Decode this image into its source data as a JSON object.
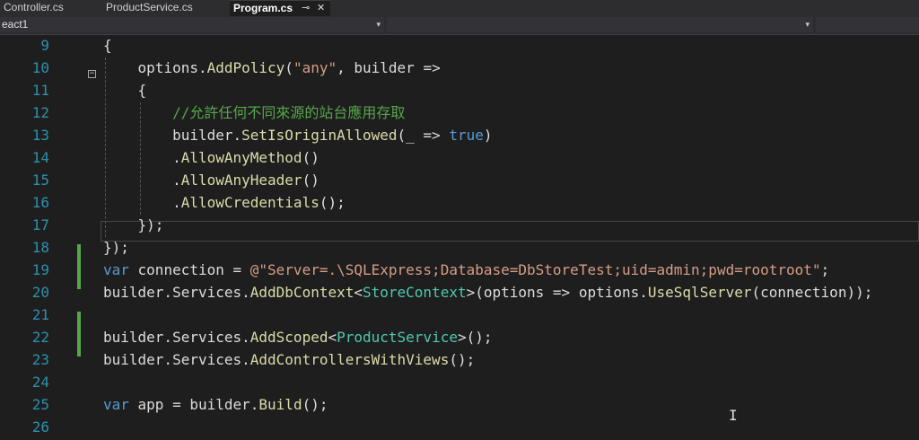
{
  "tabs": [
    {
      "label": "Controller.cs"
    },
    {
      "label": "ProductService.cs"
    },
    {
      "label": "Program.cs",
      "pin": "⊸",
      "close": "✕"
    }
  ],
  "nav": {
    "project": "eact1",
    "left_arrow": "▾",
    "right_arrow": "▾"
  },
  "editor": {
    "line_numbers": [
      "9",
      "10",
      "11",
      "12",
      "13",
      "14",
      "15",
      "16",
      "17",
      "18",
      "19",
      "20",
      "21",
      "22",
      "23",
      "24",
      "25",
      "26"
    ],
    "lines": [
      {
        "n": "9",
        "tokens": [
          {
            "t": "{"
          }
        ]
      },
      {
        "n": "10",
        "tokens": [
          {
            "t": "    options."
          },
          {
            "t": "AddPolicy",
            "c": "mt"
          },
          {
            "t": "("
          },
          {
            "t": "\"any\"",
            "c": "str"
          },
          {
            "t": ", builder =>"
          }
        ]
      },
      {
        "n": "11",
        "tokens": [
          {
            "t": "    {"
          }
        ]
      },
      {
        "n": "12",
        "tokens": [
          {
            "t": "        "
          },
          {
            "t": "//允許任何不同來源的站台應用存取",
            "c": "cm"
          }
        ]
      },
      {
        "n": "13",
        "tokens": [
          {
            "t": "        builder."
          },
          {
            "t": "SetIsOriginAllowed",
            "c": "mt"
          },
          {
            "t": "(_ => "
          },
          {
            "t": "true",
            "c": "kw"
          },
          {
            "t": ")"
          }
        ]
      },
      {
        "n": "14",
        "tokens": [
          {
            "t": "        ."
          },
          {
            "t": "AllowAnyMethod",
            "c": "mt"
          },
          {
            "t": "()"
          }
        ]
      },
      {
        "n": "15",
        "tokens": [
          {
            "t": "        ."
          },
          {
            "t": "AllowAnyHeader",
            "c": "mt"
          },
          {
            "t": "()"
          }
        ]
      },
      {
        "n": "16",
        "tokens": [
          {
            "t": "        ."
          },
          {
            "t": "AllowCredentials",
            "c": "mt"
          },
          {
            "t": "();"
          }
        ]
      },
      {
        "n": "17",
        "tokens": [
          {
            "t": "    });"
          }
        ]
      },
      {
        "n": "18",
        "tokens": [
          {
            "t": "});"
          }
        ]
      },
      {
        "n": "19",
        "tokens": [
          {
            "t": "var",
            "c": "kw"
          },
          {
            "t": " connection = "
          },
          {
            "t": "@\"Server=.\\SQLExpress;Database=DbStoreTest;uid=admin;pwd=rootroot\"",
            "c": "str"
          },
          {
            "t": ";"
          }
        ]
      },
      {
        "n": "20",
        "tokens": [
          {
            "t": "builder.Services."
          },
          {
            "t": "AddDbContext",
            "c": "mt"
          },
          {
            "t": "<"
          },
          {
            "t": "StoreContext",
            "c": "ty"
          },
          {
            "t": ">(options => options."
          },
          {
            "t": "UseSqlServer",
            "c": "mt"
          },
          {
            "t": "(connection));"
          }
        ]
      },
      {
        "n": "21",
        "tokens": []
      },
      {
        "n": "22",
        "tokens": [
          {
            "t": "builder.Services."
          },
          {
            "t": "AddScoped",
            "c": "mt"
          },
          {
            "t": "<"
          },
          {
            "t": "ProductService",
            "c": "ty"
          },
          {
            "t": ">();"
          }
        ]
      },
      {
        "n": "23",
        "tokens": [
          {
            "t": "builder.Services."
          },
          {
            "t": "AddControllersWithViews",
            "c": "mt"
          },
          {
            "t": "();"
          }
        ]
      },
      {
        "n": "24",
        "tokens": []
      },
      {
        "n": "25",
        "tokens": [
          {
            "t": "var",
            "c": "kw"
          },
          {
            "t": " app = builder."
          },
          {
            "t": "Build",
            "c": "mt"
          },
          {
            "t": "();"
          }
        ]
      },
      {
        "n": "26",
        "tokens": []
      }
    ],
    "fold_glyph": "−",
    "caret_glyph": "I",
    "colors": {
      "keyword": "#569cd6",
      "string": "#d69d85",
      "comment": "#57a64a",
      "type": "#4ec9b0",
      "method": "#dcdcaa",
      "line_number": "#2b91af",
      "change_bar": "#57a64a"
    }
  }
}
